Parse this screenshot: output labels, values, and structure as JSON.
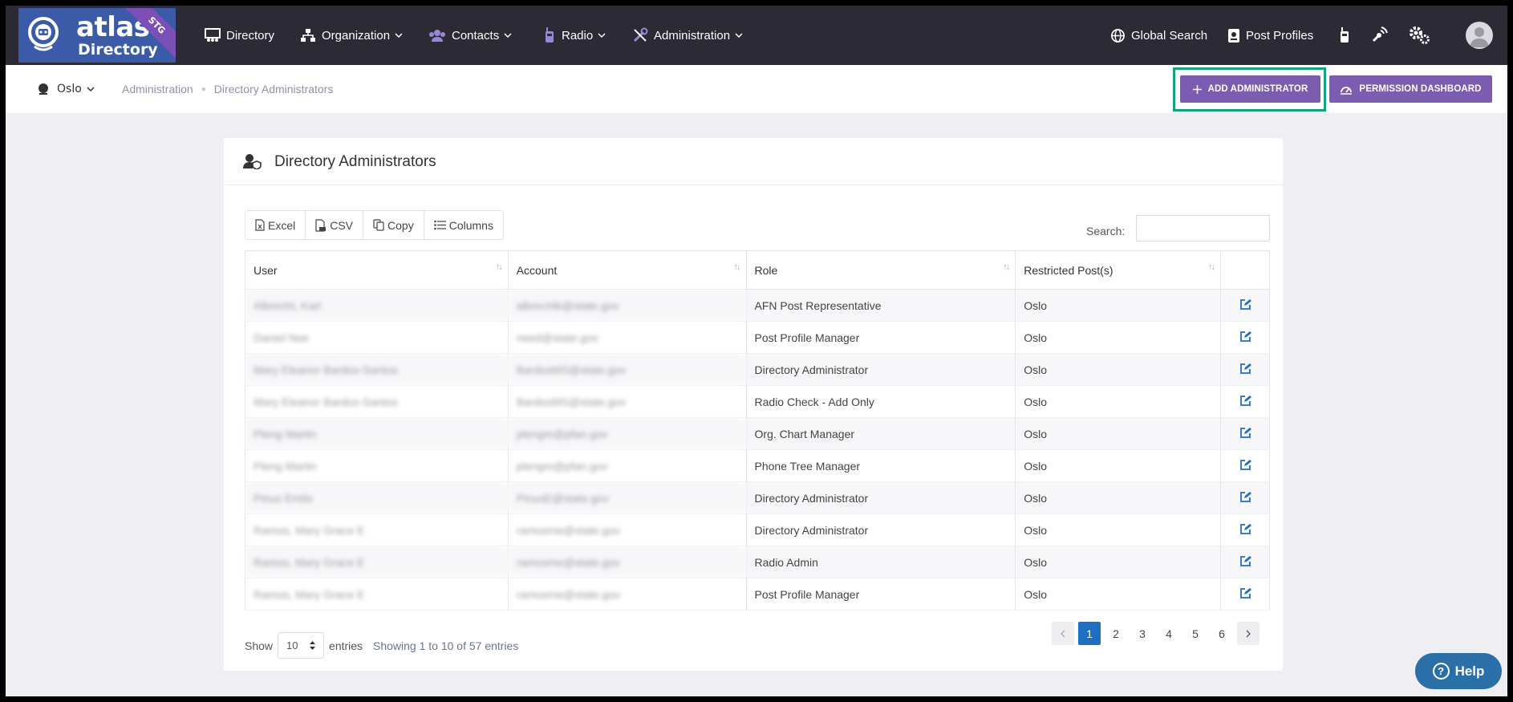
{
  "brand": {
    "name": "atlas",
    "sub": "Directory",
    "env": "STG"
  },
  "nav": {
    "directory": "Directory",
    "organization": "Organization",
    "contacts": "Contacts",
    "radio": "Radio",
    "administration": "Administration",
    "global_search": "Global Search",
    "post_profiles": "Post Profiles"
  },
  "subheader": {
    "post": "Oslo",
    "breadcrumb": [
      "Administration",
      "Directory Administrators"
    ],
    "add_admin": "ADD ADMINISTRATOR",
    "perm_dashboard": "PERMISSION DASHBOARD"
  },
  "card": {
    "title": "Directory Administrators",
    "buttons": {
      "excel": "Excel",
      "csv": "CSV",
      "copy": "Copy",
      "columns": "Columns"
    },
    "search_label": "Search:",
    "search_value": ""
  },
  "table": {
    "headers": [
      "User",
      "Account",
      "Role",
      "Restricted Post(s)"
    ],
    "rows": [
      {
        "user": "Albrecht, Karl",
        "account": "albrechtk@state.gov",
        "role": "AFN Post Representative",
        "post": "Oslo"
      },
      {
        "user": "Daniel Nee",
        "account": "need@state.gov",
        "role": "Post Profile Manager",
        "post": "Oslo"
      },
      {
        "user": "Mary Eleanor Bardos-Santos",
        "account": "BardosMS@state.gov",
        "role": "Directory Administrator",
        "post": "Oslo"
      },
      {
        "user": "Mary Eleanor Bardos-Santos",
        "account": "BardosMS@state.gov",
        "role": "Radio Check - Add Only",
        "post": "Oslo"
      },
      {
        "user": "Pleng Martin",
        "account": "plengm@pfan.gov",
        "role": "Org. Chart Manager",
        "post": "Oslo"
      },
      {
        "user": "Pleng Martin",
        "account": "plengm@pfan.gov",
        "role": "Phone Tree Manager",
        "post": "Oslo"
      },
      {
        "user": "Pinus Emilo",
        "account": "PinusE@state.gov",
        "role": "Directory Administrator",
        "post": "Oslo"
      },
      {
        "user": "Ramos, Mary Grace E",
        "account": "ramosme@state.gov",
        "role": "Directory Administrator",
        "post": "Oslo"
      },
      {
        "user": "Ramos, Mary Grace E",
        "account": "ramosme@state.gov",
        "role": "Radio Admin",
        "post": "Oslo"
      },
      {
        "user": "Ramos, Mary Grace E",
        "account": "ramosme@state.gov",
        "role": "Post Profile Manager",
        "post": "Oslo"
      }
    ]
  },
  "footer": {
    "show": "Show",
    "page_size": "10",
    "entries": "entries",
    "info": "Showing 1 to 10 of 57 entries",
    "pages": [
      "1",
      "2",
      "3",
      "4",
      "5",
      "6"
    ]
  },
  "help": "Help",
  "colors": {
    "nav_bg": "#2b2a35",
    "accent": "#7b5cb0",
    "highlight": "#12a37d",
    "pager_active": "#1e6fc1",
    "help_bg": "#2a6fa7"
  }
}
